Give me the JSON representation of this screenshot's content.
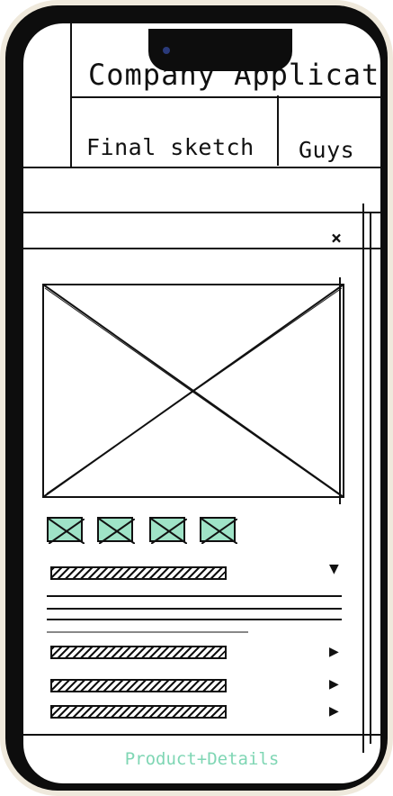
{
  "app": {
    "title": "Company Application",
    "tabs": [
      "Final sketch",
      "Guys"
    ]
  },
  "dialog": {
    "close_label": "×",
    "thumbnails": 4
  },
  "options": [
    {
      "arrow": "▼"
    },
    {
      "arrow": "▶"
    },
    {
      "arrow": "▶"
    },
    {
      "arrow": "▶"
    }
  ],
  "footer": {
    "caption": "Product+Details"
  },
  "colors": {
    "accent": "#9fe3c7",
    "caption": "#7fd6b4",
    "frame": "#efe9dc"
  }
}
